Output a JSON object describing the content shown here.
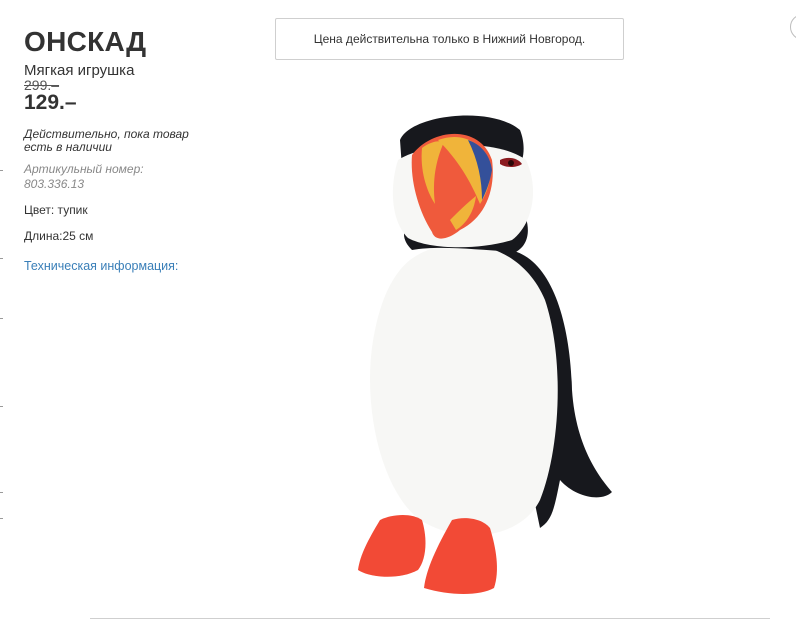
{
  "product": {
    "name": "ОНСКАД",
    "type": "Мягкая игрушка",
    "old_price": "299.–",
    "price": "129.–",
    "availability": "Действительно, пока товар есть в наличии",
    "article_label": "Артикульный номер: 803.336.13",
    "color": "Цвет: тупик",
    "length": "Длина:25 см",
    "tech_info_link": "Техническая информация:"
  },
  "notice": {
    "text": "Цена действительна только в Нижний Новгород."
  },
  "image": {
    "icon": "puffin-plush-toy",
    "colors": {
      "body": "#f7f7f5",
      "black": "#17181d",
      "beak_red": "#ef5a3c",
      "beak_yellow": "#f0b43a",
      "beak_blue": "#34509a",
      "feet": "#f24a36"
    }
  },
  "theme": {
    "link_color": "#3a7fb8",
    "text_color": "#333333",
    "muted_color": "#888888"
  }
}
